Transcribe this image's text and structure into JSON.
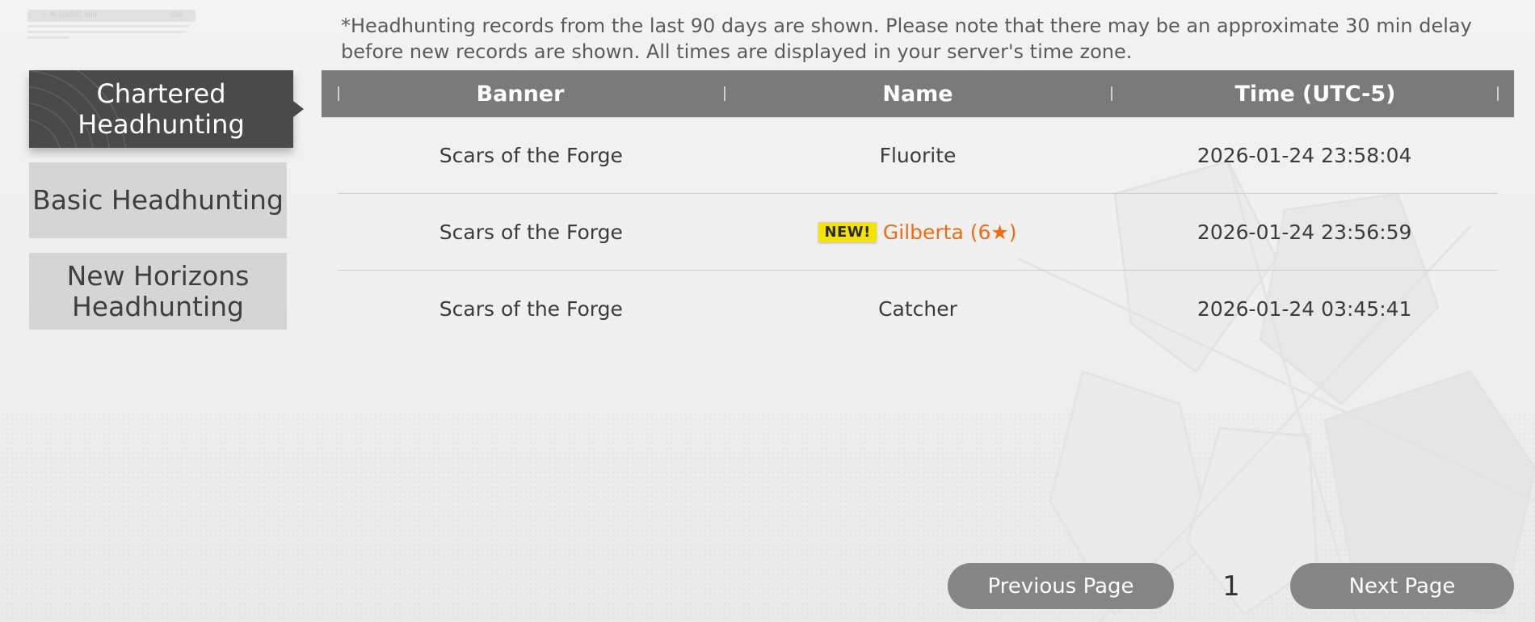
{
  "header": {
    "faint_title": "— ⊞ ▯▯▯▯▯▯ ▯▯▯",
    "faint_badge": "▯▯▯"
  },
  "sidebar": {
    "items": [
      {
        "label_line1": "Chartered",
        "label_line2": "Headhunting",
        "active": true
      },
      {
        "label_line1": "Basic Headhunting",
        "label_line2": "",
        "active": false
      },
      {
        "label_line1": "New Horizons",
        "label_line2": "Headhunting",
        "active": false
      }
    ]
  },
  "notice": "*Headhunting records from the last 90 days are shown. Please note that there may be an approximate 30 min delay before new records are shown. All times are displayed in your server's time zone.",
  "table": {
    "headers": [
      "Banner",
      "Name",
      "Time (UTC-5)"
    ],
    "rows": [
      {
        "banner": "Scars of the Forge",
        "name": "Fluorite",
        "badge": "",
        "time": "2026-01-24 23:58:04",
        "rare": false
      },
      {
        "banner": "Scars of the Forge",
        "name": "Gilberta (6★)",
        "badge": "NEW!",
        "time": "2026-01-24 23:56:59",
        "rare": true
      },
      {
        "banner": "Scars of the Forge",
        "name": "Catcher",
        "badge": "",
        "time": "2026-01-24 03:45:41",
        "rare": false
      }
    ]
  },
  "pagination": {
    "prev_label": "Previous Page",
    "page": "1",
    "next_label": "Next Page"
  },
  "colors": {
    "active_tab_bg": "#4a4a4a",
    "inactive_tab_bg": "#d5d5d5",
    "table_header_bg": "#7a7a7a",
    "rare_name": "#f26a12",
    "new_badge_bg": "#f5e400",
    "page_button_bg": "#858585"
  }
}
